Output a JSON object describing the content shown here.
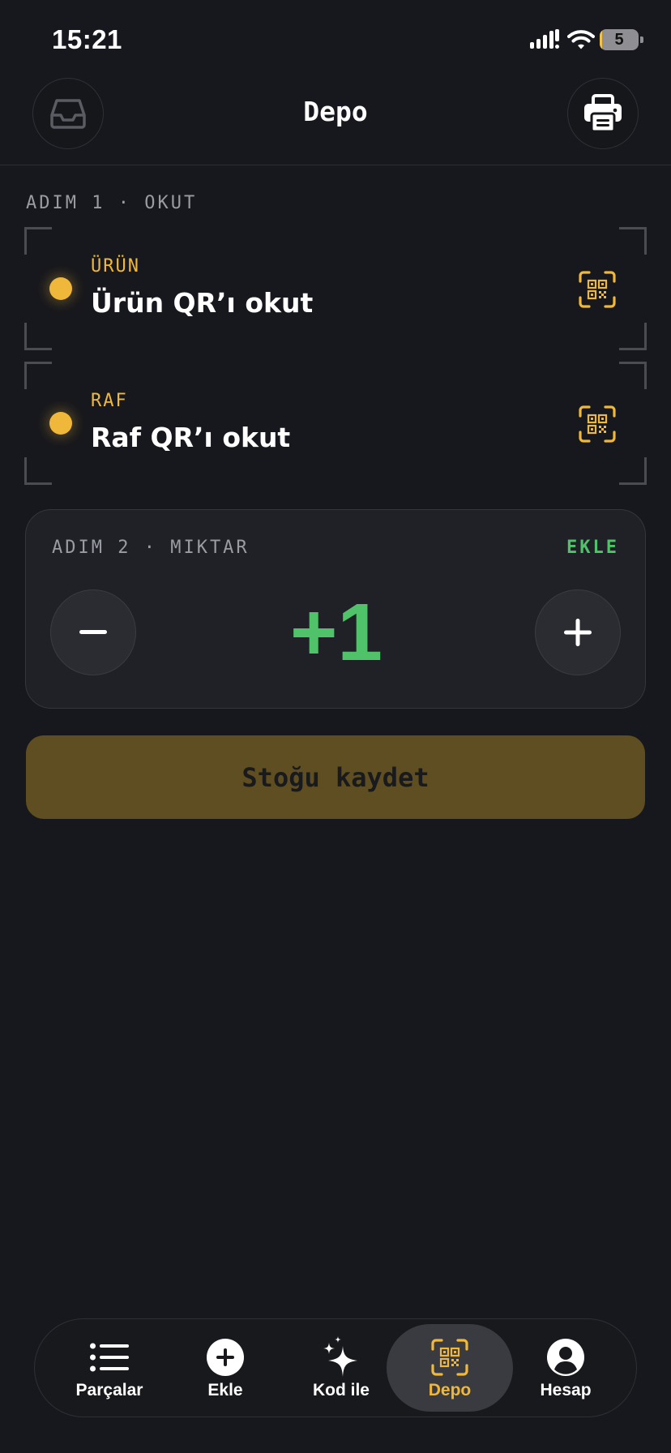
{
  "status_bar": {
    "time": "15:21",
    "battery_text": "5",
    "battery_level": 0.05
  },
  "header": {
    "title": "Depo",
    "left_icon": "inbox-tray-icon",
    "right_icon": "printer-icon"
  },
  "step1": {
    "label": "ADIM 1 · OKUT",
    "items": [
      {
        "tag": "ÜRÜN",
        "title": "Ürün QR’ı okut",
        "icon": "qr-scan-icon"
      },
      {
        "tag": "RAF",
        "title": "Raf QR’ı okut",
        "icon": "qr-scan-icon"
      }
    ]
  },
  "step2": {
    "label": "ADIM 2 · MIKTAR",
    "action": "EKLE",
    "quantity": "+1",
    "minus_icon": "minus-icon",
    "plus_icon": "plus-icon"
  },
  "save_label": "Stoğu kaydet",
  "tabs": [
    {
      "label": "Parçalar",
      "icon": "list-icon",
      "active": false
    },
    {
      "label": "Ekle",
      "icon": "plus-circle-icon",
      "active": false
    },
    {
      "label": "Kod ile",
      "icon": "sparkles-icon",
      "active": false
    },
    {
      "label": "Depo",
      "icon": "qr-scan-icon",
      "active": true
    },
    {
      "label": "Hesap",
      "icon": "account-icon",
      "active": false
    }
  ],
  "colors": {
    "background": "#17181d",
    "accent": "#f0b83a",
    "green": "#4fc26a",
    "save_button": "#5f4e21"
  }
}
